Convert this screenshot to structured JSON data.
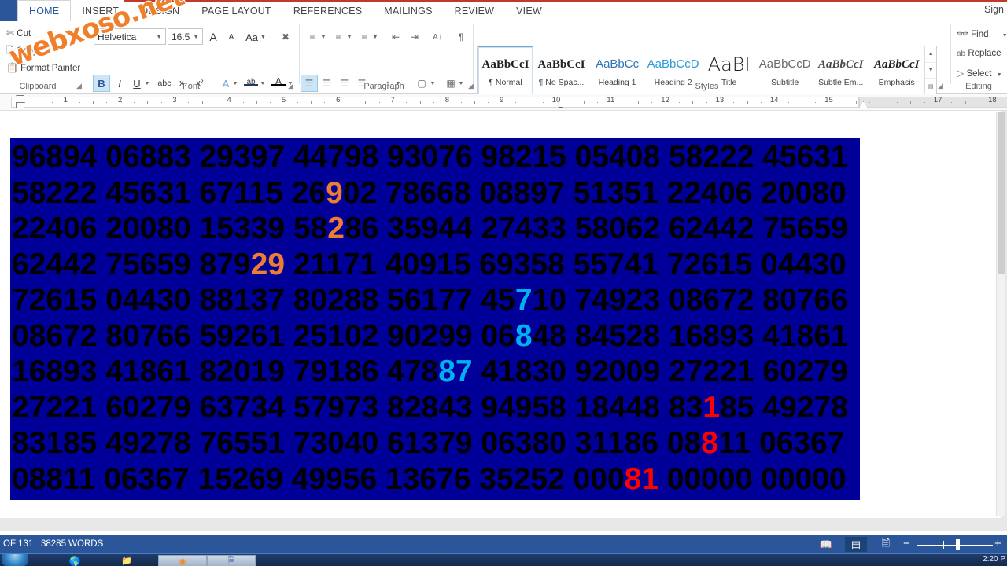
{
  "window": {
    "signin_label": "Sign",
    "watermark": "webxoso.net"
  },
  "tabs": [
    {
      "label": "HOME",
      "active": true
    },
    {
      "label": "INSERT",
      "active": false
    },
    {
      "label": "DESIGN",
      "active": false
    },
    {
      "label": "PAGE LAYOUT",
      "active": false
    },
    {
      "label": "REFERENCES",
      "active": false
    },
    {
      "label": "MAILINGS",
      "active": false
    },
    {
      "label": "REVIEW",
      "active": false
    },
    {
      "label": "VIEW",
      "active": false
    }
  ],
  "ribbon": {
    "clipboard": {
      "group_label": "Clipboard",
      "cut_label": "Cut",
      "copy_label": "Copy",
      "format_painter_label": "Format Painter",
      "cut_icon": "scissors-icon",
      "copy_icon": "copy-icon",
      "paste_icon": "paste-icon"
    },
    "font": {
      "group_label": "Font",
      "font_name": "Helvetica",
      "font_size": "16.5",
      "grow_font": "A",
      "shrink_font": "A",
      "change_case": "Aa",
      "clear_formatting_icon": "clear-formatting-icon",
      "bold": "B",
      "italic": "I",
      "underline": "U",
      "strikethrough": "abc",
      "subscript": "x₂",
      "superscript": "x²",
      "text_effects": "A",
      "highlight": "ab",
      "font_color": "A"
    },
    "paragraph": {
      "group_label": "Paragraph",
      "bullets_icon": "bullet-list-icon",
      "numbering_icon": "numbered-list-icon",
      "multilevel_icon": "multilevel-list-icon",
      "decrease_indent_icon": "decrease-indent-icon",
      "increase_indent_icon": "increase-indent-icon",
      "sort_icon": "sort-icon",
      "show_marks": "¶",
      "align_left_icon": "align-left-icon",
      "align_center_icon": "align-center-icon",
      "align_right_icon": "align-right-icon",
      "justify_icon": "justify-icon",
      "line_spacing_icon": "line-spacing-icon",
      "shading_icon": "shading-icon",
      "borders_icon": "borders-icon"
    },
    "styles": {
      "group_label": "Styles",
      "items": [
        {
          "preview": "AaBbCcI",
          "name": "¶ Normal",
          "selected": true,
          "color": "#1f1f1f",
          "style": "serif"
        },
        {
          "preview": "AaBbCcI",
          "name": "¶ No Spac...",
          "selected": false,
          "color": "#1f1f1f",
          "style": "serif"
        },
        {
          "preview": "AaBbCc",
          "name": "Heading 1",
          "selected": false,
          "color": "#2e74b5",
          "style": "sans"
        },
        {
          "preview": "AaBbCcD",
          "name": "Heading 2",
          "selected": false,
          "color": "#2e9bd6",
          "style": "sans"
        },
        {
          "preview": "AaBI",
          "name": "Title",
          "selected": false,
          "color": "#1f1f1f",
          "style": "title"
        },
        {
          "preview": "AaBbCcD",
          "name": "Subtitle",
          "selected": false,
          "color": "#6b6b6b",
          "style": "sans"
        },
        {
          "preview": "AaBbCcI",
          "name": "Subtle Em...",
          "selected": false,
          "color": "#4a4a4a",
          "style": "italic"
        },
        {
          "preview": "AaBbCcI",
          "name": "Emphasis",
          "selected": false,
          "color": "#1f1f1f",
          "style": "italic"
        }
      ]
    },
    "editing": {
      "group_label": "Editing",
      "find_label": "Find",
      "replace_label": "Replace",
      "select_label": "Select",
      "find_icon": "binoculars-icon",
      "replace_icon": "replace-icon",
      "select_icon": "select-cursor-icon"
    }
  },
  "ruler": {
    "numbers": [
      1,
      2,
      3,
      4,
      5,
      6,
      7,
      8,
      9,
      10,
      11,
      12,
      13,
      14,
      15,
      17,
      18
    ],
    "tab_stop_marker": "L"
  },
  "document": {
    "background_color": "#000099",
    "text_color": "#000000",
    "highlight_colors": {
      "orange": "#ED7D31",
      "cyan": "#00B0F0",
      "red": "#FF0000"
    },
    "lines": [
      [
        {
          "t": "96894 06883 29397 44798 93076 98215 05408 58222 45631",
          "c": ""
        }
      ],
      [
        {
          "t": "58222 45631 67115 26",
          "c": ""
        },
        {
          "t": "9",
          "c": "orange"
        },
        {
          "t": "02 78668 08897 51351 22406 20080",
          "c": ""
        }
      ],
      [
        {
          "t": "22406 20080 15339 58",
          "c": ""
        },
        {
          "t": "2",
          "c": "orange"
        },
        {
          "t": "86 35944 27433 58062 62442 75659",
          "c": ""
        }
      ],
      [
        {
          "t": "62442 75659 879",
          "c": ""
        },
        {
          "t": "29",
          "c": "orange"
        },
        {
          "t": " 21171 40915 69358 55741 72615 04430",
          "c": ""
        }
      ],
      [
        {
          "t": "72615 04430 88137 80288 56177 45",
          "c": ""
        },
        {
          "t": "7",
          "c": "cyan"
        },
        {
          "t": "10 74923 08672 80766",
          "c": ""
        }
      ],
      [
        {
          "t": "08672 80766 59261 25102 90299 06",
          "c": ""
        },
        {
          "t": "8",
          "c": "cyan"
        },
        {
          "t": "48 84528 16893 41861",
          "c": ""
        }
      ],
      [
        {
          "t": "16893 41861 82019 79186 478",
          "c": ""
        },
        {
          "t": "87",
          "c": "cyan"
        },
        {
          "t": " 41830 92009 27221 60279",
          "c": ""
        }
      ],
      [
        {
          "t": "27221 60279 63734 57973 82843 94958 18448 83",
          "c": ""
        },
        {
          "t": "1",
          "c": "red"
        },
        {
          "t": "85 49278",
          "c": ""
        }
      ],
      [
        {
          "t": "83185 49278 76551 73040 61379 06380 31186 08",
          "c": ""
        },
        {
          "t": "8",
          "c": "red"
        },
        {
          "t": "11 06367",
          "c": ""
        }
      ],
      [
        {
          "t": "08811 06367 15269 49956 13676 35252 000",
          "c": ""
        },
        {
          "t": "81",
          "c": "red"
        },
        {
          "t": " 00000 00000",
          "c": ""
        }
      ]
    ]
  },
  "statusbar": {
    "page_text": "OF 131",
    "word_count": "38285 WORDS",
    "read_mode_icon": "read-mode-icon",
    "print_layout_icon": "print-layout-icon",
    "web_layout_icon": "web-layout-icon",
    "zoom_out": "−",
    "zoom_in": "+"
  },
  "taskbar": {
    "start_icon": "start-orb-icon",
    "items": [
      {
        "icon": "internet-explorer-icon",
        "active": false
      },
      {
        "icon": "file-explorer-icon",
        "active": false
      },
      {
        "icon": "media-player-icon",
        "active": false
      },
      {
        "icon": "chrome-icon",
        "active": true
      },
      {
        "icon": "word-icon",
        "active": true
      }
    ],
    "clock": "2:20 P"
  }
}
